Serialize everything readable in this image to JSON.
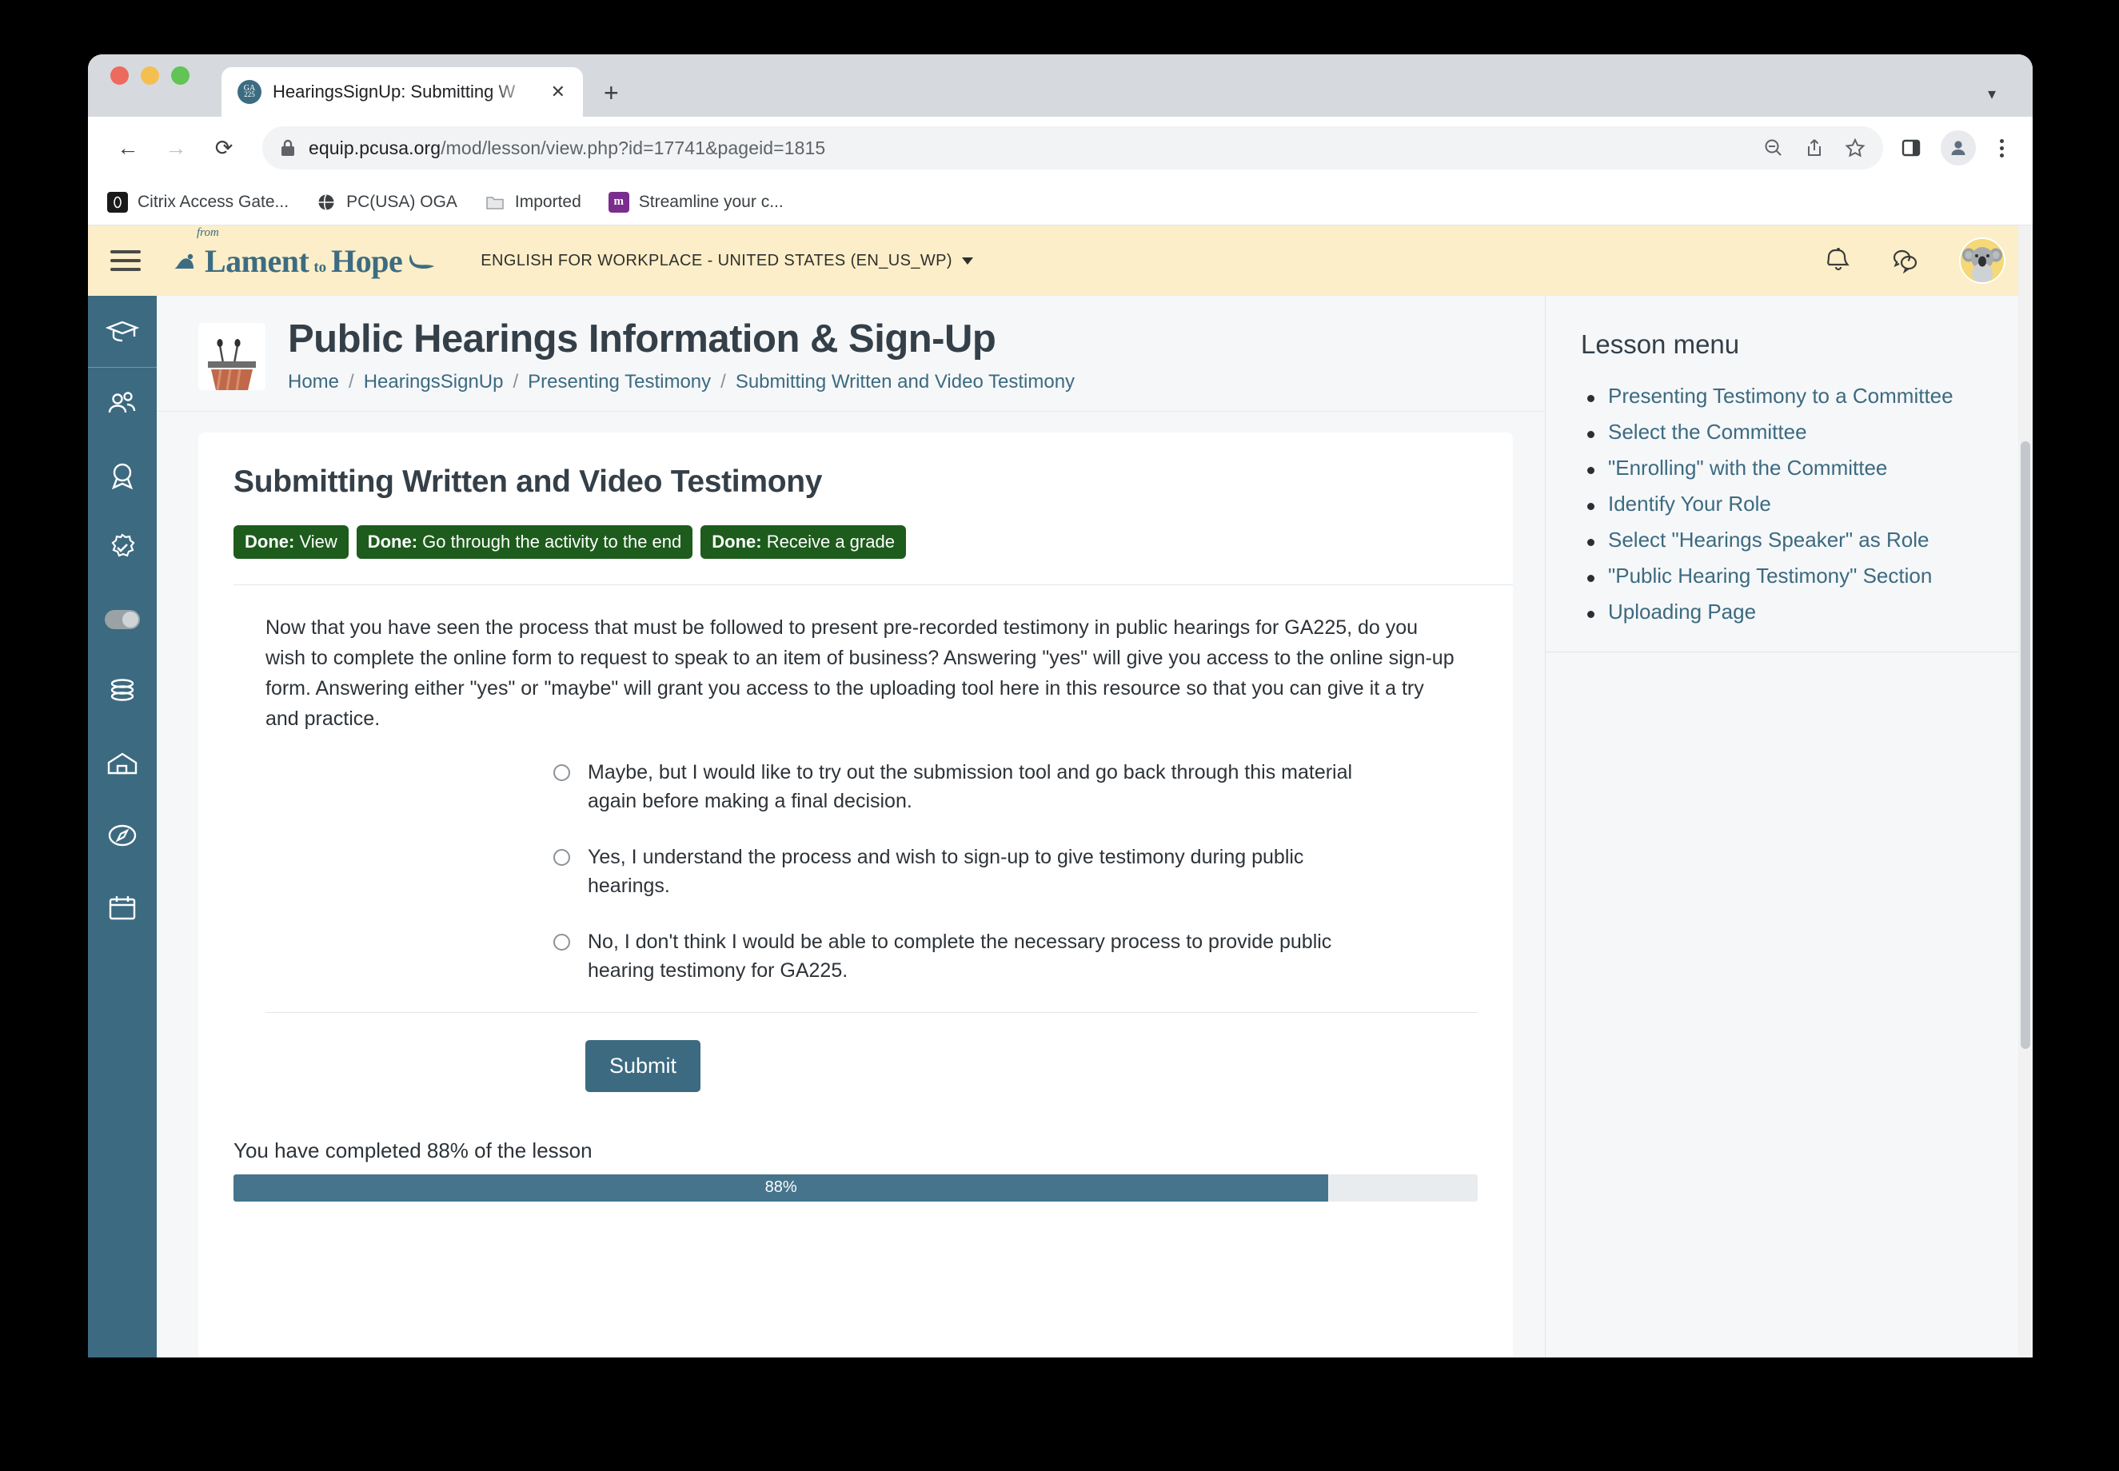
{
  "browser": {
    "tab": {
      "title": "HearingsSignUp: Submitting W",
      "favicon_top": "GA",
      "favicon_bottom": "225",
      "close_label": "✕",
      "newtab_label": "+",
      "expand_label": "▾"
    },
    "nav": {
      "back": "←",
      "forward": "→",
      "reload": "⟳"
    },
    "omnibox": {
      "lock_icon": "lock-icon",
      "url_domain": "equip.pcusa.org",
      "url_path": "/mod/lesson/view.php?id=17741&pageid=1815",
      "zoom_out_icon": "zoom-out-icon",
      "share_icon": "share-icon",
      "star_icon": "star-icon"
    },
    "toolbar_right": {
      "side_panel_icon": "side-panel-icon",
      "profile_icon": "profile-icon",
      "menu_icon": "kebab-menu-icon"
    },
    "bookmarks": [
      {
        "label": "Citrix Access Gate...",
        "icon": "citrix-icon"
      },
      {
        "label": "PC(USA) OGA",
        "icon": "globe-icon"
      },
      {
        "label": "Imported",
        "icon": "folder-icon"
      },
      {
        "label": "Streamline your c...",
        "icon": "moodle-icon"
      }
    ]
  },
  "site_header": {
    "menu_toggle": "hamburger-icon",
    "logo": {
      "from": "from",
      "lament": "Lament",
      "to": "to",
      "hope": "Hope"
    },
    "language": "ENGLISH FOR WORKPLACE - UNITED STATES (EN_US_WP)",
    "notifications_icon": "bell-icon",
    "messages_icon": "chat-bubbles-icon",
    "avatar": "koala-avatar"
  },
  "rail": [
    {
      "name": "sidebar-item-courses",
      "icon": "graduation-cap-icon",
      "active": true
    },
    {
      "name": "sidebar-item-participants",
      "icon": "users-icon",
      "active": false
    },
    {
      "name": "sidebar-item-badges",
      "icon": "award-ribbon-icon",
      "active": false
    },
    {
      "name": "sidebar-item-competencies",
      "icon": "badge-check-icon",
      "active": false
    },
    {
      "name": "sidebar-item-toggle",
      "icon": "toggle-switch-icon",
      "active": false
    },
    {
      "name": "sidebar-item-database",
      "icon": "database-icon",
      "active": false
    },
    {
      "name": "sidebar-item-home",
      "icon": "home-icon",
      "active": false
    },
    {
      "name": "sidebar-item-explore",
      "icon": "compass-icon",
      "active": false
    },
    {
      "name": "sidebar-item-calendar",
      "icon": "calendar-icon",
      "active": false
    }
  ],
  "page": {
    "course_icon": "podium-microphones-icon",
    "title": "Public Hearings Information & Sign-Up",
    "breadcrumb": [
      "Home",
      "HearingsSignUp",
      "Presenting Testimony",
      "Submitting Written and Video Testimony"
    ],
    "breadcrumb_separator": "/"
  },
  "lesson": {
    "heading": "Submitting Written and Video Testimony",
    "completion_badges": [
      {
        "prefix": "Done:",
        "text": " View"
      },
      {
        "prefix": "Done:",
        "text": " Go through the activity to the end"
      },
      {
        "prefix": "Done:",
        "text": " Receive a grade"
      }
    ],
    "body": "Now that you have seen the process that must be followed to present pre-recorded testimony in public hearings for GA225, do you wish to complete the online form to request to speak to an item of business? Answering \"yes\" will give you access to the online sign-up form. Answering either \"yes\" or \"maybe\" will grant you access to the uploading tool here in this resource so that you can give it a try and practice.",
    "options": [
      {
        "label": "Maybe, but I would like to try out the submission tool and go back through this material again before making a final decision.",
        "selected": false
      },
      {
        "label": "Yes, I understand the process and wish to sign-up to give testimony during public hearings.",
        "selected": false
      },
      {
        "label": "No, I don't think I would be able to complete the necessary process to provide public hearing testimony for GA225.",
        "selected": false
      }
    ],
    "submit_label": "Submit",
    "progress_label": "You have completed 88% of the lesson",
    "progress_value": "88%",
    "progress_percent": 88
  },
  "lesson_menu": {
    "title": "Lesson menu",
    "items": [
      "Presenting Testimony to a Committee",
      "Select the Committee",
      "\"Enrolling\" with the Committee",
      "Identify Your Role",
      "Select \"Hearings Speaker\" as Role",
      "\"Public Hearing Testimony\" Section",
      "Uploading Page"
    ]
  },
  "colors": {
    "header_cream": "#fbeec8",
    "brand_teal": "#3c6a80",
    "badge_green": "#1d5c1c",
    "progress_fill": "#46748c",
    "link": "#3c6a80"
  }
}
